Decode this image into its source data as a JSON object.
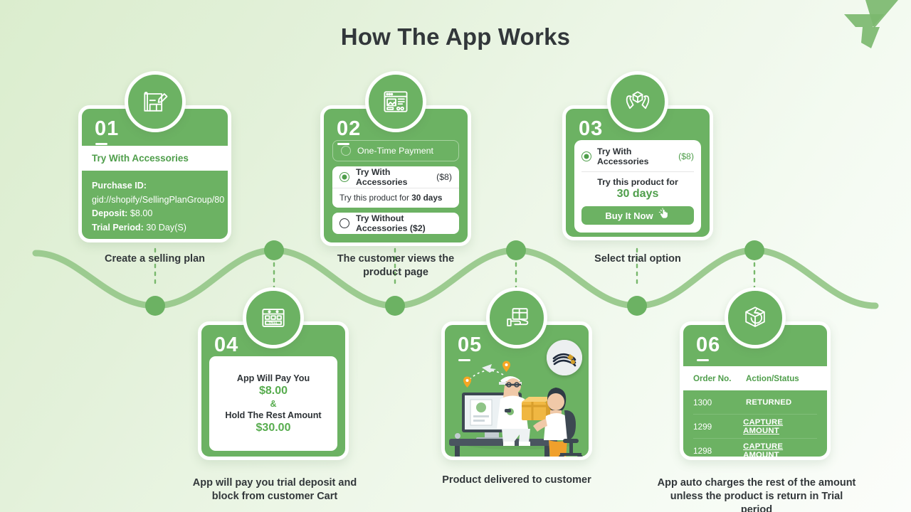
{
  "header": {
    "title": "How The App Works",
    "logo_icon": "arrow-plane-logo",
    "accent_green": "#6cb263",
    "text_dark": "#32373a",
    "label_green": "#4f9e4b"
  },
  "steps": [
    {
      "number": "01",
      "icon": "blueprint-pencil-icon",
      "caption": "Create a selling plan",
      "plan_title": "Try With Accessories",
      "fields": [
        {
          "label": "Purchase ID:",
          "value": "gid://shopify/SellingPlanGroup/80"
        },
        {
          "label": "Deposit:",
          "value": "$8.00"
        },
        {
          "label": "Trial Period:",
          "value": "30 Day(S)"
        }
      ]
    },
    {
      "number": "02",
      "icon": "product-page-icon",
      "caption": "The customer views the product page",
      "options": [
        {
          "label": "One-Time Payment",
          "price": "",
          "selected": false,
          "style": "outline"
        },
        {
          "label": "Try With Accessories",
          "price": "($8)",
          "selected": true,
          "style": "white",
          "sub_prefix": "Try this product for ",
          "sub_strong": "30 days"
        },
        {
          "label": "Try Without Accessories ($2)",
          "price": "",
          "selected": false,
          "style": "white"
        }
      ]
    },
    {
      "number": "03",
      "icon": "hands-box-icon",
      "caption": "Select trial option",
      "option_label": "Try With Accessories",
      "option_price": "($8)",
      "trial_line1": "Try this product for",
      "trial_line2": "30 days",
      "button_label": "Buy It Now",
      "button_icon": "click-hand-icon"
    },
    {
      "number": "04",
      "icon": "trial-calendar-icon",
      "caption": "App will pay you trial deposit and block from customer Cart",
      "pay_label": "App Will Pay You",
      "pay_amount": "$8.00",
      "amp": "&",
      "hold_label": "Hold The Rest Amount",
      "hold_amount": "$30.00"
    },
    {
      "number": "05",
      "icon": "hand-package-icon",
      "caption": "Product delivered to customer",
      "illustration": "courier-delivering-package-to-seated-customer",
      "thumbnail": "leather-bracelet-product-thumbnail"
    },
    {
      "number": "06",
      "icon": "return-box-icon",
      "caption": "App auto charges the rest of the amount unless the product is return in Trial period",
      "table": {
        "columns": [
          "Order No.",
          "Action/Status"
        ],
        "rows": [
          {
            "order": "1300",
            "status": "RETURNED",
            "underline": false
          },
          {
            "order": "1299",
            "status": "CAPTURE AMOUNT",
            "underline": true
          },
          {
            "order": "1298",
            "status": "CAPTURE AMOUNT",
            "underline": true
          }
        ]
      }
    }
  ],
  "connector": {
    "icon": "wavy-timeline",
    "node_count": 6
  }
}
